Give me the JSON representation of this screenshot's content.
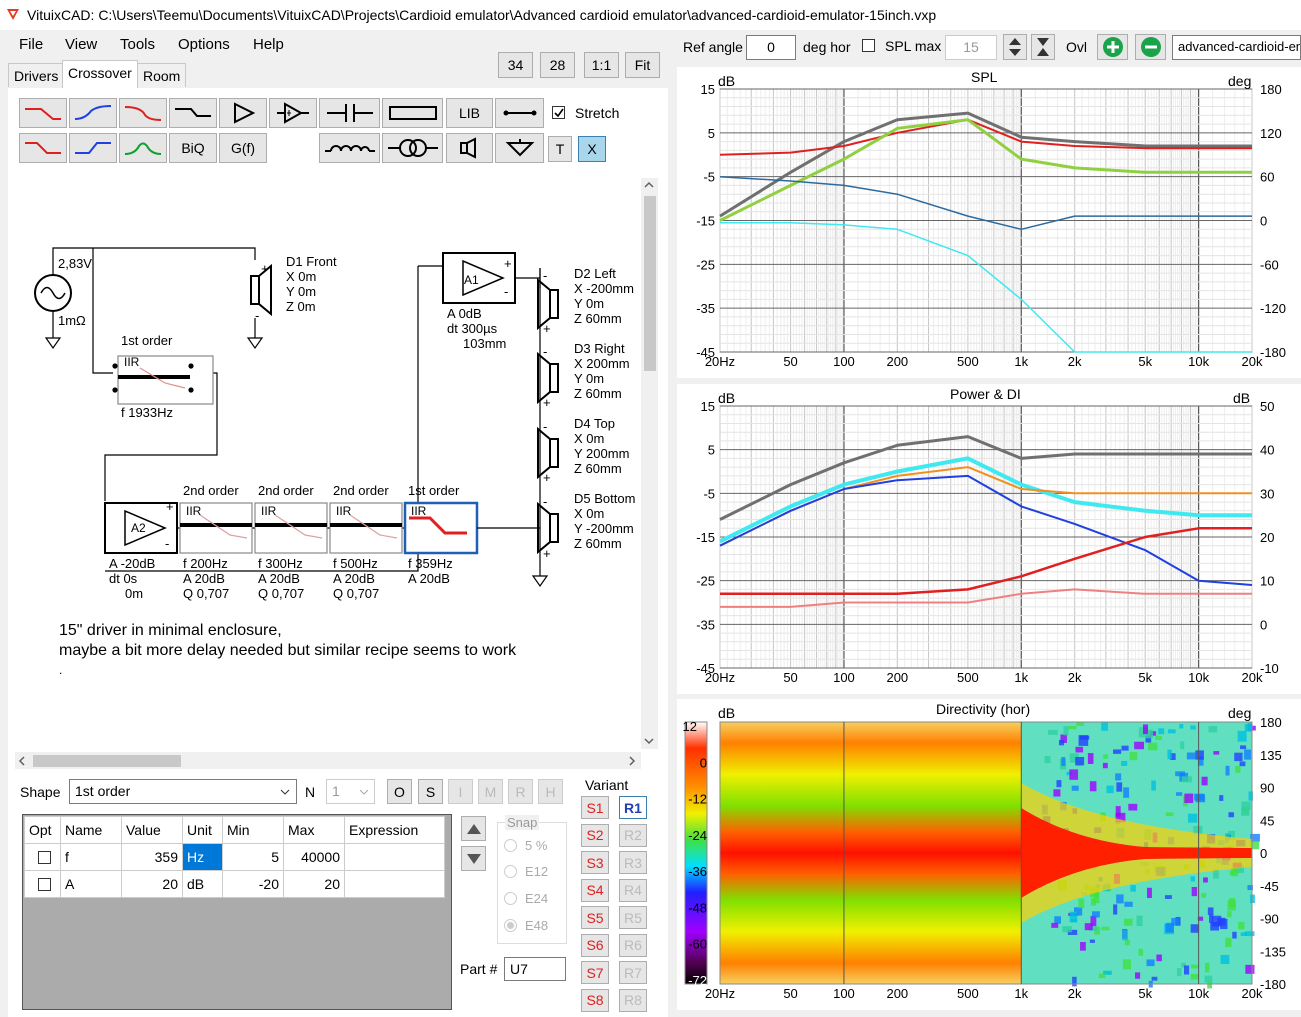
{
  "window": {
    "title": "VituixCAD: C:\\Users\\Teemu\\Documents\\VituixCAD\\Projects\\Cardioid emulator\\Advanced cardioid emulator\\advanced-cardioid-emulator-15inch.vxp"
  },
  "menu": [
    "File",
    "View",
    "Tools",
    "Options",
    "Help"
  ],
  "tabs": [
    "Drivers",
    "Crossover",
    "Room"
  ],
  "zoom": {
    "a": "34",
    "b": "28",
    "c": "1:1",
    "d": "Fit"
  },
  "toolbar": {
    "biq": "BiQ",
    "gf": "G(f)",
    "lib": "LIB",
    "t": "T",
    "x": "X",
    "stretch": "Stretch"
  },
  "topbar": {
    "ref_angle_label": "Ref angle",
    "ref_angle": "0",
    "deg_hor": "deg hor",
    "spl_max": "SPL max",
    "spl_max_val": "15",
    "ovl": "Ovl",
    "file_field": "advanced-cardioid-em"
  },
  "schematic": {
    "gen_v": "2,83V",
    "gen_r": "1mΩ",
    "d1": [
      "D1 Front",
      "X 0m",
      "Y 0m",
      "Z 0m"
    ],
    "a1": [
      "A 0dB",
      "dt 300µs",
      "103mm"
    ],
    "a1_name": "A1",
    "a2_name": "A2",
    "a2": [
      "A -20dB",
      "dt 0s",
      "0m"
    ],
    "f1_order": "1st order",
    "f1_type": "IIR",
    "f1_vals": [
      "f  1933Hz"
    ],
    "f2_order": "2nd order",
    "f2_type": "IIR",
    "f2_vals": [
      "f  200Hz",
      "A  20dB",
      "Q  0,707"
    ],
    "f3_order": "2nd order",
    "f3_type": "IIR",
    "f3_vals": [
      "f  300Hz",
      "A  20dB",
      "Q  0,707"
    ],
    "f4_order": "2nd order",
    "f4_type": "IIR",
    "f4_vals": [
      "f  500Hz",
      "A  20dB",
      "Q  0,707"
    ],
    "f5_order": "1st order",
    "f5_type": "IIR",
    "f5_vals": [
      "f  359Hz",
      "A  20dB"
    ],
    "d2": [
      "D2 Left",
      "X -200mm",
      "Y 0m",
      "Z 60mm"
    ],
    "d3": [
      "D3 Right",
      "X 200mm",
      "Y 0m",
      "Z 60mm"
    ],
    "d4": [
      "D4 Top",
      "X 0m",
      "Y 200mm",
      "Z 60mm"
    ],
    "d5": [
      "D5 Bottom",
      "X 0m",
      "Y -200mm",
      "Z 60mm"
    ],
    "note1": "15\" driver in minimal enclosure,",
    "note2": "maybe a bit more delay needed but similar recipe seems to work",
    "note3": "."
  },
  "shape": {
    "label": "Shape",
    "value": "1st order",
    "n_label": "N",
    "n_value": "1",
    "o": "O",
    "s": "S",
    "i": "I",
    "m": "M",
    "r": "R",
    "h": "H"
  },
  "params": {
    "headers": [
      "Opt",
      "Name",
      "Value",
      "Unit",
      "Min",
      "Max",
      "Expression"
    ],
    "rows": [
      [
        "",
        "f",
        "359",
        "Hz",
        "5",
        "40000",
        ""
      ],
      [
        "",
        "A",
        "20",
        "dB",
        "-20",
        "20",
        ""
      ]
    ]
  },
  "snap": {
    "label": "Snap",
    "opts": [
      "5 %",
      "E12",
      "E24",
      "E48"
    ]
  },
  "part": {
    "label": "Part #",
    "value": "U7"
  },
  "variant": {
    "label": "Variant",
    "s": [
      "S1",
      "S2",
      "S3",
      "S4",
      "S5",
      "S6",
      "S7",
      "S8"
    ],
    "r": [
      "R1",
      "R2",
      "R3",
      "R4",
      "R5",
      "R6",
      "R7",
      "R8"
    ]
  },
  "charts": {
    "xticks": [
      "20Hz",
      "50",
      "100",
      "200",
      "500",
      "1k",
      "2k",
      "5k",
      "10k",
      "20k"
    ],
    "spl": {
      "title": "SPL",
      "lunit": "dB",
      "runit": "deg",
      "yl": [
        "15",
        "5",
        "-5",
        "-15",
        "-25",
        "-35",
        "-45"
      ],
      "yr": [
        "180",
        "120",
        "60",
        "0",
        "-60",
        "-120",
        "-180"
      ]
    },
    "power": {
      "title": "Power & DI",
      "lunit": "dB",
      "runit": "dB",
      "yl": [
        "15",
        "5",
        "-5",
        "-15",
        "-25",
        "-35",
        "-45"
      ],
      "yr": [
        "50",
        "40",
        "30",
        "20",
        "10",
        "0",
        "-10"
      ]
    },
    "dir": {
      "title": "Directivity (hor)",
      "lunit": "dB",
      "runit": "deg",
      "cbar": [
        "12",
        "0",
        "-12",
        "-24",
        "-36",
        "-48",
        "-60",
        "-72"
      ],
      "yr": [
        "180",
        "135",
        "90",
        "45",
        "0",
        "-45",
        "-90",
        "-135",
        "-180"
      ]
    }
  },
  "colors": {
    "red": "#e02020",
    "blue": "#2040e0",
    "green": "#10a030",
    "cyan": "#40e8f0",
    "orange": "#f09020",
    "grey": "#707070"
  },
  "chart_data": [
    {
      "type": "line",
      "title": "SPL",
      "xlabel": "",
      "ylabel": "dB",
      "x": [
        20,
        50,
        100,
        200,
        500,
        1000,
        2000,
        5000,
        10000,
        20000
      ],
      "series": [
        {
          "values": [
            -14,
            -4,
            3,
            8,
            9.5,
            4,
            3,
            2,
            2,
            2
          ]
        },
        {
          "values": [
            0,
            0.5,
            2,
            5,
            8,
            3,
            2,
            1.5,
            1.5,
            1.5
          ]
        },
        {
          "values": [
            -15,
            -7,
            -1,
            6,
            8,
            -1,
            -3,
            -4,
            -4,
            -4
          ]
        },
        {
          "values": [
            -5,
            -6,
            -7,
            -9,
            -14,
            -17,
            -14,
            -14,
            -14,
            -14
          ]
        },
        {
          "values": [
            -15.5,
            -15.5,
            -16,
            -17,
            -23,
            -33,
            -45,
            -45,
            -45,
            -45
          ]
        }
      ]
    },
    {
      "type": "line",
      "title": "Power & DI",
      "xlabel": "",
      "ylabel": "dB",
      "x": [
        20,
        50,
        100,
        200,
        500,
        1000,
        2000,
        5000,
        10000,
        20000
      ],
      "series": [
        {
          "values": [
            -11,
            -3,
            2,
            6,
            8,
            3,
            4,
            4,
            4,
            4
          ]
        },
        {
          "values": [
            -16,
            -8,
            -3,
            0,
            3,
            -3,
            -7,
            -9,
            -10,
            -10
          ]
        },
        {
          "values": [
            -17,
            -9,
            -4,
            -1,
            1,
            -4,
            -5,
            -5,
            -5,
            -5
          ]
        },
        {
          "values": [
            -17,
            -9,
            -4,
            -2,
            -1,
            -8,
            -12,
            -18,
            -25,
            -26
          ]
        },
        {
          "values": [
            -28,
            -28,
            -28,
            -28,
            -27,
            -24,
            -20,
            -15,
            -13,
            -13
          ]
        },
        {
          "values": [
            -31,
            -31,
            -30,
            -30,
            -30,
            -28,
            -27,
            -28,
            -28,
            -28
          ]
        }
      ]
    }
  ]
}
